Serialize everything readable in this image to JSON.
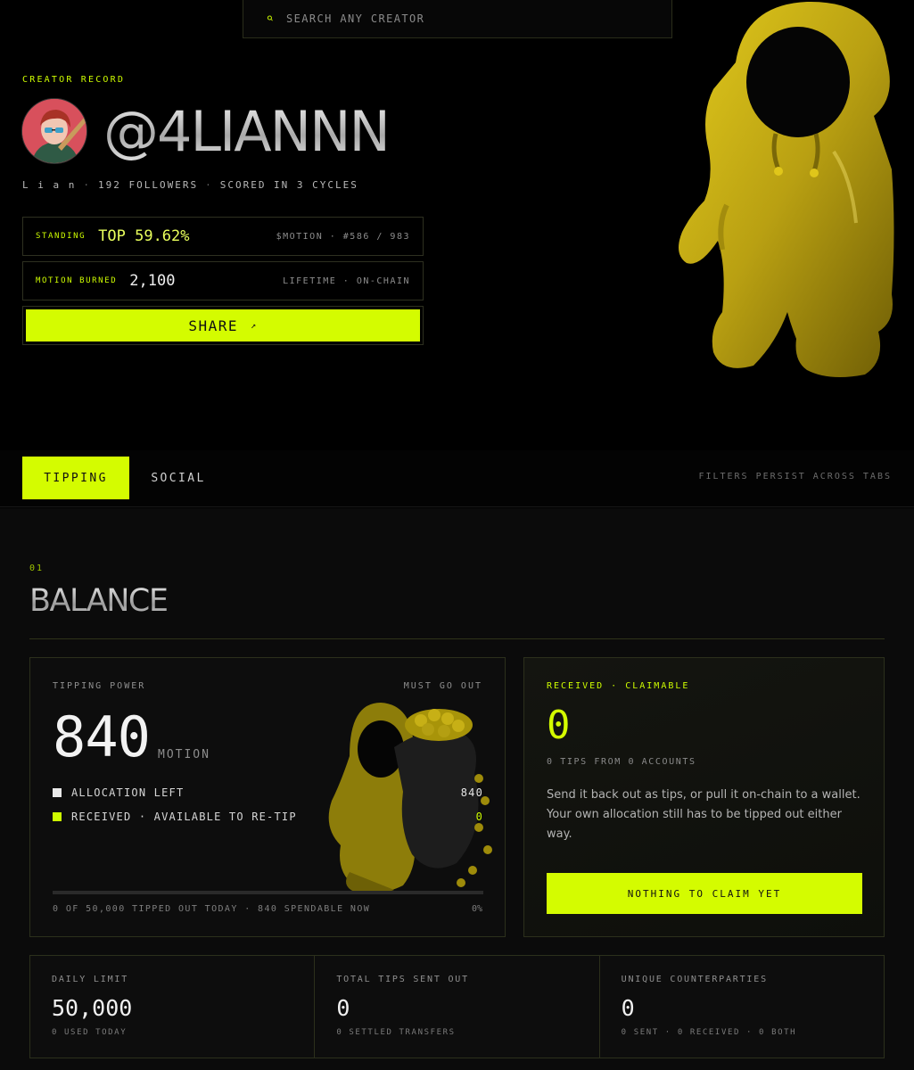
{
  "search": {
    "placeholder": "SEARCH ANY CREATOR"
  },
  "profile": {
    "eyebrow": "CREATOR RECORD",
    "handle": "@4LIANNN",
    "name": "L i a n",
    "followers": "192 FOLLOWERS",
    "scored": "SCORED IN 3 CYCLES"
  },
  "standing": {
    "label": "STANDING",
    "value": "TOP 59.62%",
    "right": "$MOTION · #586 / 983"
  },
  "burned": {
    "label": "MOTION BURNED",
    "value": "2,100",
    "right": "LIFETIME · ON-CHAIN"
  },
  "share": {
    "label": "SHARE",
    "arrow": "↗"
  },
  "tabs": {
    "active": "TIPPING",
    "inactive": "SOCIAL",
    "note": "FILTERS PERSIST ACROSS TABS"
  },
  "section": {
    "number": "01",
    "title": "BALANCE"
  },
  "power": {
    "label": "TIPPING POWER",
    "label_right": "MUST GO OUT",
    "value": "840",
    "unit": "MOTION",
    "legend": [
      {
        "label": "ALLOCATION LEFT",
        "value": "840"
      },
      {
        "label": "RECEIVED · AVAILABLE TO RE-TIP",
        "value": "0"
      }
    ],
    "progress_fraction": 0,
    "footer": "0 OF 50,000 TIPPED OUT TODAY · 840 SPENDABLE NOW",
    "footer_right": "0%"
  },
  "claim": {
    "label": "RECEIVED · CLAIMABLE",
    "value": "0",
    "sub": "0 TIPS FROM 0 ACCOUNTS",
    "description": "Send it back out as tips, or pull it on-chain to a wallet. Your own allocation still has to be tipped out either way.",
    "button": "NOTHING TO CLAIM YET"
  },
  "stats": [
    {
      "label": "DAILY LIMIT",
      "value": "50,000",
      "sub": "0 USED TODAY"
    },
    {
      "label": "TOTAL TIPS SENT OUT",
      "value": "0",
      "sub": "0 SETTLED TRANSFERS"
    },
    {
      "label": "UNIQUE COUNTERPARTIES",
      "value": "0",
      "sub": "0 SENT · 0 RECEIVED · 0 BOTH"
    }
  ],
  "colors": {
    "accent": "#d4fc00",
    "background": "#000000",
    "panel": "#0b0b0b"
  },
  "icons": {
    "search": "search-icon",
    "share": "arrow-up-right-icon"
  }
}
